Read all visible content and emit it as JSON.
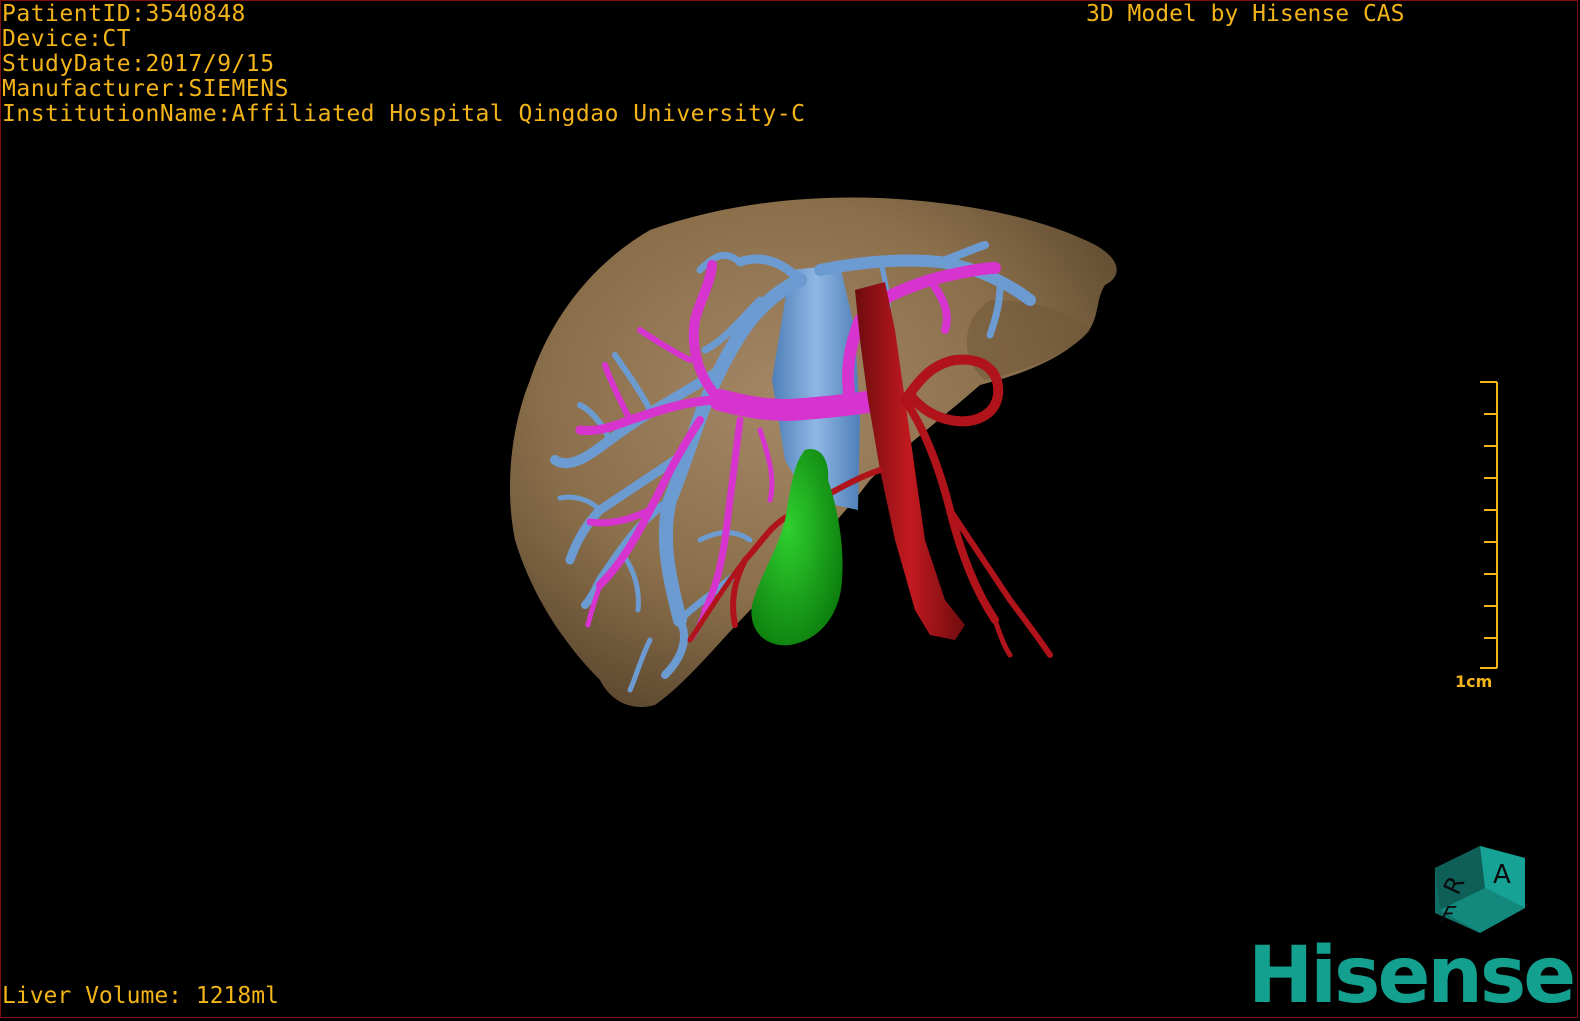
{
  "patient": {
    "id_line": "PatientID:3540848",
    "device_line": "Device:CT",
    "study_date_line": "StudyDate:2017/9/15",
    "manufacturer_line": "Manufacturer:SIEMENS",
    "institution_line": "InstitutionName:Affiliated Hospital Qingdao University-C"
  },
  "credit": "3D Model by Hisense CAS",
  "measurements": {
    "liver_volume": "Liver Volume: 1218ml",
    "scale_label": "1cm"
  },
  "orientation_cube": {
    "face_a": "A",
    "face_r": "R",
    "face_f": "F"
  },
  "brand": "Hisense",
  "colors": {
    "overlay_text": "#f2b418",
    "liver": "#8b6f4b",
    "hepatic_vein": "#6c9bd2",
    "portal_vein": "#d633cf",
    "artery": "#b0141a",
    "gallbladder": "#14a014",
    "brand": "#13a08e"
  }
}
